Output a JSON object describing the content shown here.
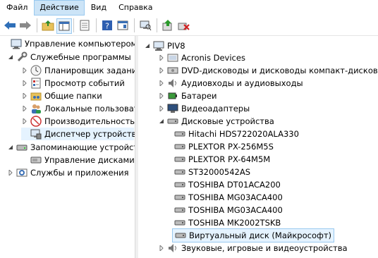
{
  "menu": [
    "Файл",
    "Действие",
    "Вид",
    "Справка"
  ],
  "left_tree": {
    "root": "Управление компьютером (л",
    "service_tools": "Служебные программы",
    "items": [
      "Планировщик заданий",
      "Просмотр событий",
      "Общие папки",
      "Локальные пользовате",
      "Производительность",
      "Диспетчер устройств"
    ],
    "storage": "Запоминающие устройст",
    "disk_mgmt": "Управление дисками",
    "services": "Службы и приложения"
  },
  "right_tree": {
    "computer": "PIV8",
    "categories_top": [
      "Acronis Devices",
      "DVD-дисководы и дисководы компакт-дисков",
      "Аудиовходы и аудиовыходы",
      "Батареи",
      "Видеоадаптеры"
    ],
    "disk_category": "Дисковые устройства",
    "disks": [
      "Hitachi HDS722020ALA330",
      "PLEXTOR PX-256M5S",
      "PLEXTOR PX-64M5M",
      "ST32000542AS",
      "TOSHIBA DT01ACA200",
      "TOSHIBA MG03ACA400",
      "TOSHIBA MG03ACA400",
      "TOSHIBA MK2002TSKB",
      "Виртуальный диск (Майкрософт)"
    ],
    "sound": "Звуковые, игровые и видеоустройства"
  }
}
